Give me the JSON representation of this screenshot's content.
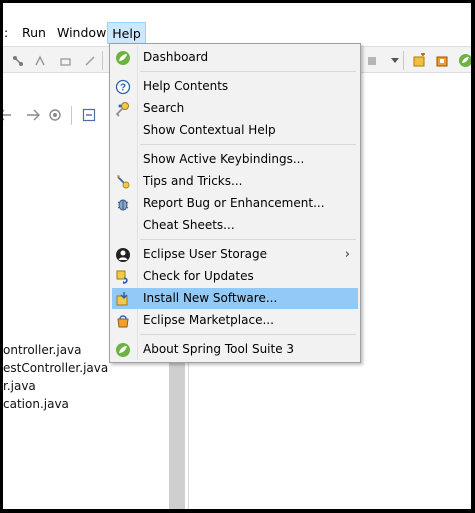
{
  "menubar": {
    "file_fragment": ":",
    "run": "Run",
    "window": "Window",
    "help": "Help"
  },
  "help_menu": {
    "items": [
      {
        "label": "Dashboard",
        "icon": "spring-leaf-icon"
      },
      {
        "label": "Help Contents",
        "icon": "question-circle-icon"
      },
      {
        "label": "Search",
        "icon": "search-key-icon"
      },
      {
        "label": "Show Contextual Help",
        "icon": ""
      },
      {
        "label": "Show Active Keybindings...",
        "icon": ""
      },
      {
        "label": "Tips and Tricks...",
        "icon": "tips-icon"
      },
      {
        "label": "Report Bug or Enhancement...",
        "icon": "bug-icon"
      },
      {
        "label": "Cheat Sheets...",
        "icon": ""
      },
      {
        "label": "Eclipse User Storage",
        "icon": "user-storage-icon",
        "submenu": true
      },
      {
        "label": "Check for Updates",
        "icon": "update-icon"
      },
      {
        "label": "Install New Software...",
        "icon": "install-icon",
        "highlighted": true
      },
      {
        "label": "Eclipse Marketplace...",
        "icon": "marketplace-icon"
      },
      {
        "label": "About Spring Tool Suite 3",
        "icon": "spring-leaf-icon"
      }
    ],
    "submenu_arrow": "›"
  },
  "files": [
    "ontroller.java",
    "estController.java",
    "r.java",
    "cation.java"
  ],
  "colors": {
    "highlight": "#91c9f7",
    "menubar_active": "#cce8ff",
    "spring_green": "#6db33f"
  }
}
